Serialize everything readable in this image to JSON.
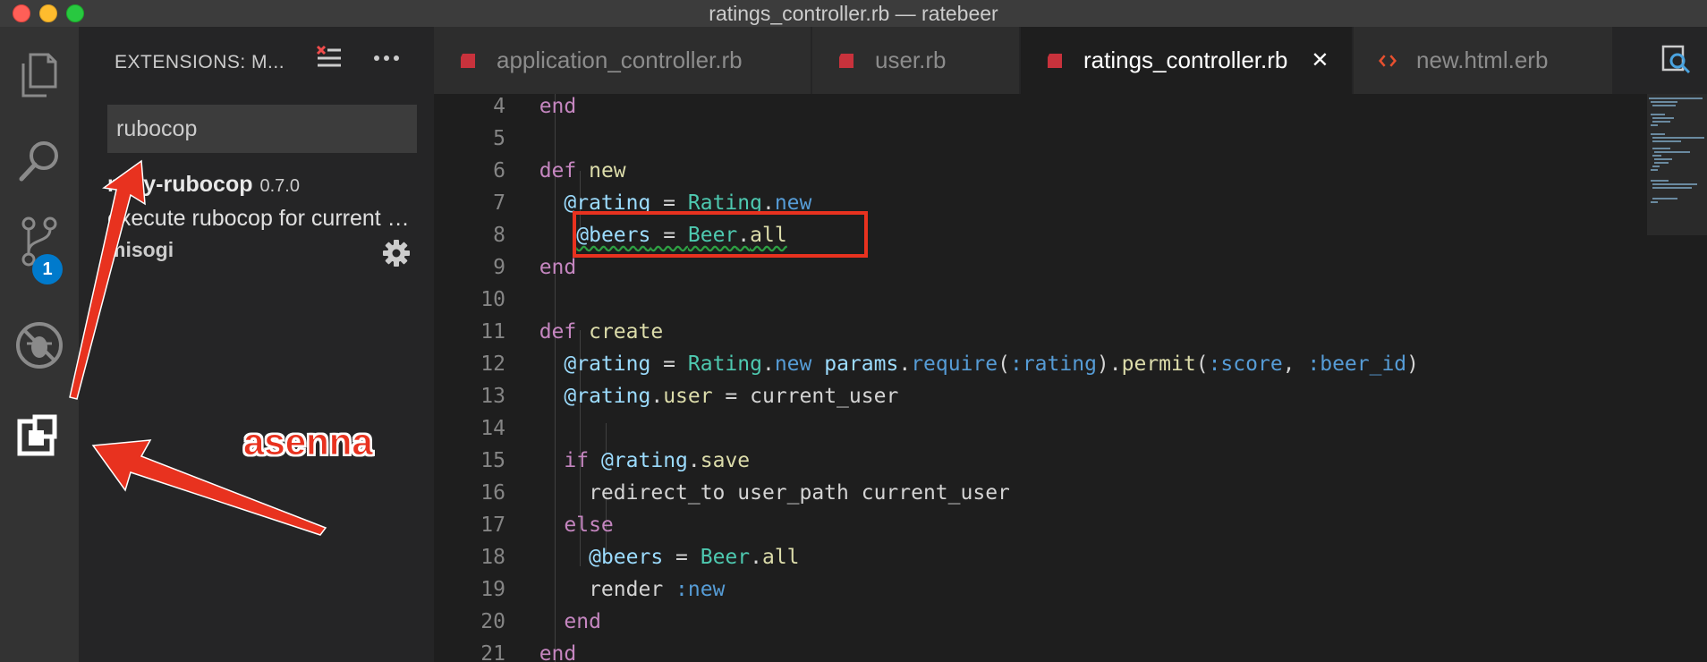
{
  "window": {
    "title": "ratings_controller.rb — ratebeer"
  },
  "activity_bar": {
    "items": [
      {
        "name": "explorer",
        "icon": "files-icon"
      },
      {
        "name": "search",
        "icon": "search-icon"
      },
      {
        "name": "source-control",
        "icon": "source-control-icon",
        "badge": "1"
      },
      {
        "name": "debug",
        "icon": "debug-icon"
      },
      {
        "name": "extensions",
        "icon": "extensions-icon"
      }
    ]
  },
  "sidebar": {
    "header": "EXTENSIONS: M...",
    "search_value": "rubocop",
    "extension": {
      "name": "ruby-rubocop",
      "version": "0.7.0",
      "description": "execute rubocop for current Ruby code.",
      "author": "misogi"
    }
  },
  "tabs": [
    {
      "label": "application_controller.rb",
      "icon": "ruby-file-icon",
      "active": false
    },
    {
      "label": "user.rb",
      "icon": "ruby-file-icon",
      "active": false
    },
    {
      "label": "ratings_controller.rb",
      "icon": "ruby-file-icon",
      "active": true,
      "close": "✕"
    },
    {
      "label": "new.html.erb",
      "icon": "html-file-icon",
      "active": false
    }
  ],
  "editor": {
    "line_numbers": [
      "4",
      "5",
      "6",
      "7",
      "8",
      "9",
      "10",
      "11",
      "12",
      "13",
      "14",
      "15",
      "16",
      "17",
      "18",
      "19",
      "20",
      "21"
    ]
  },
  "annotation": {
    "text": "asenna"
  },
  "colors": {
    "accent": "#007acc",
    "annotation_red": "#e8321f"
  }
}
